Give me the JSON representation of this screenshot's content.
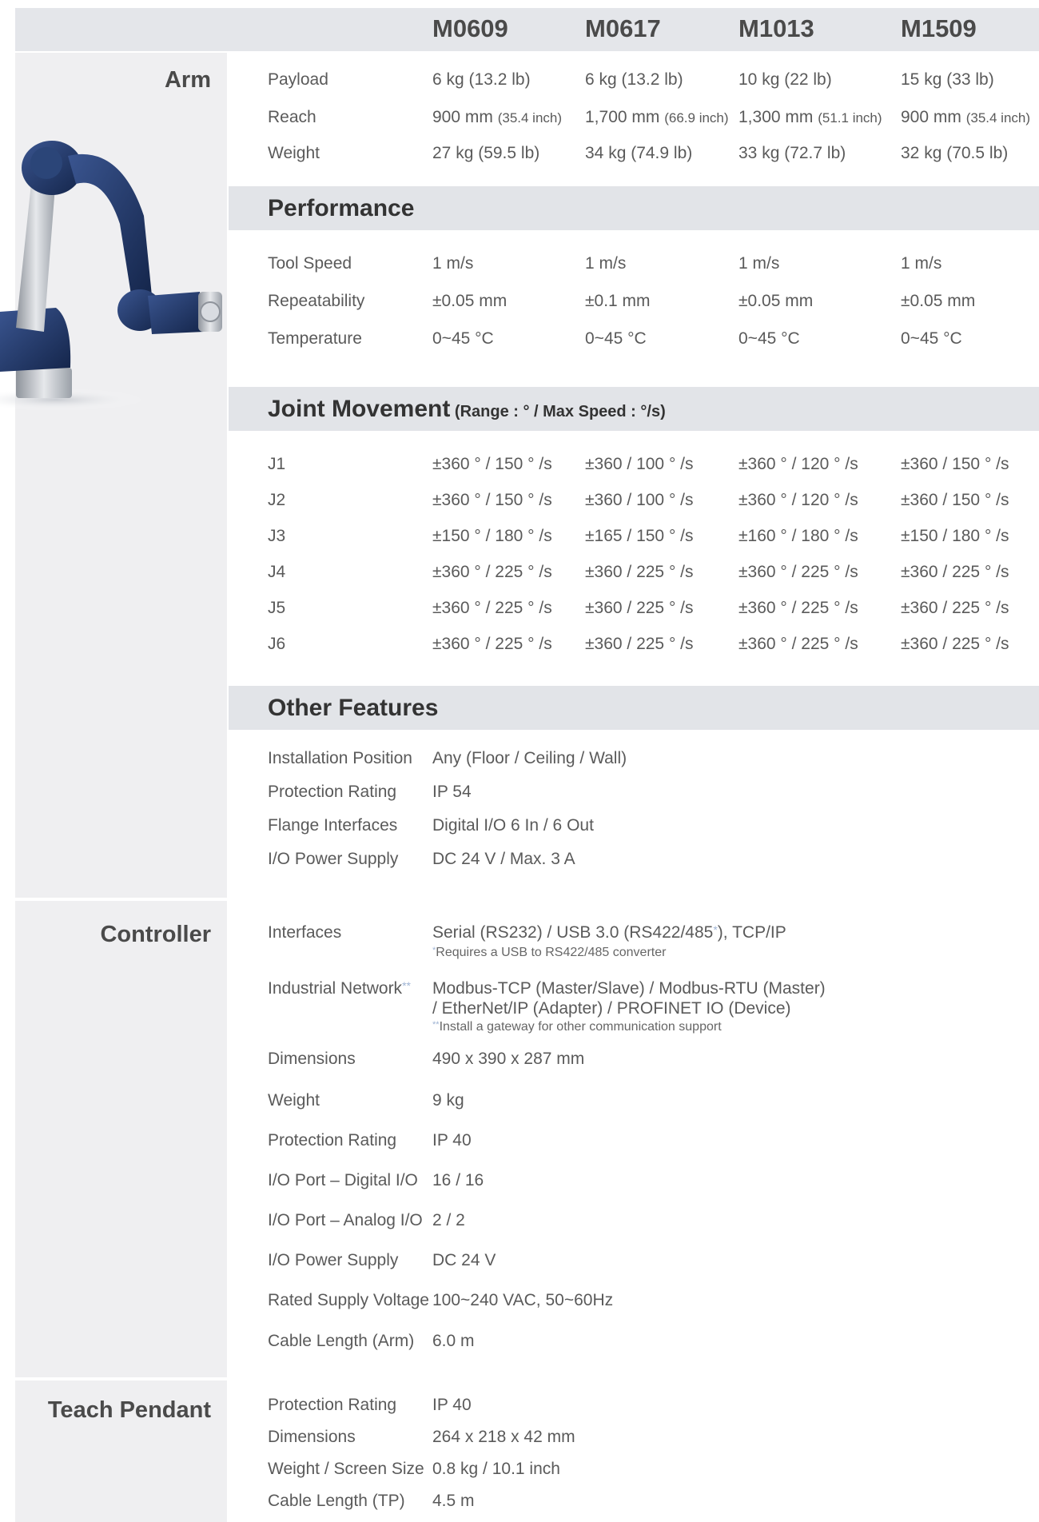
{
  "models": [
    "M0609",
    "M0617",
    "M1013",
    "M1509"
  ],
  "groups": {
    "arm": "Arm",
    "controller": "Controller",
    "teach_pendant": "Teach Pendant"
  },
  "arm": {
    "rows": [
      {
        "label": "Payload",
        "cells": [
          {
            "main": "6 kg  (13.2 lb)",
            "small": ""
          },
          {
            "main": "6 kg  (13.2 lb)",
            "small": ""
          },
          {
            "main": "10 kg  (22 lb)",
            "small": ""
          },
          {
            "main": "15 kg  (33 lb)",
            "small": ""
          }
        ]
      },
      {
        "label": "Reach",
        "cells": [
          {
            "main": "900 mm ",
            "small": "(35.4 inch)"
          },
          {
            "main": "1,700 mm ",
            "small": "(66.9 inch)"
          },
          {
            "main": "1,300 mm ",
            "small": "(51.1 inch)"
          },
          {
            "main": "900 mm ",
            "small": "(35.4 inch)"
          }
        ]
      },
      {
        "label": "Weight",
        "cells": [
          {
            "main": "27 kg (59.5 lb)",
            "small": ""
          },
          {
            "main": "34 kg (74.9 lb)",
            "small": ""
          },
          {
            "main": "33 kg (72.7 lb)",
            "small": ""
          },
          {
            "main": "32 kg (70.5 lb)",
            "small": ""
          }
        ]
      }
    ]
  },
  "performance": {
    "title": "Performance",
    "rows": [
      {
        "label": "Tool Speed",
        "cells": [
          "1 m/s",
          "1 m/s",
          "1 m/s",
          "1 m/s"
        ]
      },
      {
        "label": "Repeatability",
        "cells": [
          "±0.05 mm",
          "±0.1 mm",
          "±0.05 mm",
          "±0.05 mm"
        ]
      },
      {
        "label": "Temperature",
        "cells": [
          "0~45 °C",
          "0~45 °C",
          "0~45 °C",
          "0~45 °C"
        ]
      }
    ]
  },
  "joint": {
    "title": "Joint Movement",
    "subtitle": " (Range : °  /  Max Speed : °/s)",
    "rows": [
      {
        "label": "J1",
        "cells": [
          "±360 ° / 150 ° /s",
          "±360 / 100 ° /s",
          "±360 ° / 120 ° /s",
          "±360 / 150 ° /s"
        ]
      },
      {
        "label": "J2",
        "cells": [
          "±360 ° / 150 ° /s",
          "±360 / 100 ° /s",
          "±360 ° / 120 ° /s",
          "±360 / 150 ° /s"
        ]
      },
      {
        "label": "J3",
        "cells": [
          "±150 ° / 180 ° /s",
          "±165 / 150 ° /s",
          "±160 ° / 180 ° /s",
          "±150 / 180 ° /s"
        ]
      },
      {
        "label": "J4",
        "cells": [
          "±360 ° / 225 ° /s",
          "±360 / 225 ° /s",
          "±360 ° / 225 ° /s",
          "±360 / 225 ° /s"
        ]
      },
      {
        "label": "J5",
        "cells": [
          "±360 ° / 225 ° /s",
          "±360 / 225 ° /s",
          "±360 ° / 225 ° /s",
          "±360 / 225 ° /s"
        ]
      },
      {
        "label": "J6",
        "cells": [
          "±360 ° / 225 ° /s",
          "±360 / 225 ° /s",
          "±360 ° / 225 ° /s",
          "±360 / 225 ° /s"
        ]
      }
    ]
  },
  "other": {
    "title": "Other Features",
    "rows": [
      {
        "label": "Installation Position",
        "value": "Any (Floor / Ceiling / Wall)"
      },
      {
        "label": "Protection Rating",
        "value": "IP 54"
      },
      {
        "label": "Flange Interfaces",
        "value": "Digital I/O  6 In / 6 Out"
      },
      {
        "label": "I/O Power Supply",
        "value": "DC 24 V / Max. 3 A"
      }
    ]
  },
  "controller": {
    "interfaces_label": "Interfaces",
    "interfaces_value_a": "Serial (RS232) / USB 3.0 (RS422/485",
    "interfaces_star": "*",
    "interfaces_value_b": "), TCP/IP",
    "interfaces_note_star": "*",
    "interfaces_note": "Requires a USB to RS422/485 converter",
    "network_label": "Industrial Network",
    "network_star": "**",
    "network_line1": "Modbus-TCP (Master/Slave) / Modbus-RTU (Master)",
    "network_line2": "/ EtherNet/IP (Adapter) / PROFINET IO (Device)",
    "network_note_star": "**",
    "network_note": "Install a gateway for other communication support",
    "rows": [
      {
        "label": "Dimensions",
        "value": "490 x 390 x 287 mm"
      },
      {
        "label": "Weight",
        "value": "9 kg"
      },
      {
        "label": "Protection Rating",
        "value": "IP 40"
      },
      {
        "label": "I/O Port – Digital I/O",
        "value": "16 / 16"
      },
      {
        "label": "I/O Port – Analog I/O",
        "value": "2 / 2"
      },
      {
        "label": "I/O Power Supply",
        "value": "DC 24 V"
      },
      {
        "label": "Rated Supply Voltage",
        "value": "100~240 VAC, 50~60Hz"
      },
      {
        "label": "Cable Length (Arm)",
        "value": "6.0 m"
      }
    ]
  },
  "teach_pendant": {
    "rows": [
      {
        "label": "Protection Rating",
        "value": "IP 40"
      },
      {
        "label": "Dimensions",
        "value": "264 x 218 x 42 mm"
      },
      {
        "label": "Weight / Screen Size",
        "value": "0.8 kg / 10.1 inch"
      },
      {
        "label": "Cable Length (TP)",
        "value": "4.5 m"
      }
    ]
  },
  "colors": {
    "header_bar": "#e4e6ea",
    "left_column": "#efeff1",
    "section_bar": "#e2e4e8",
    "robot_blue": "#1f3566",
    "robot_silver": "#b9bdc4"
  }
}
